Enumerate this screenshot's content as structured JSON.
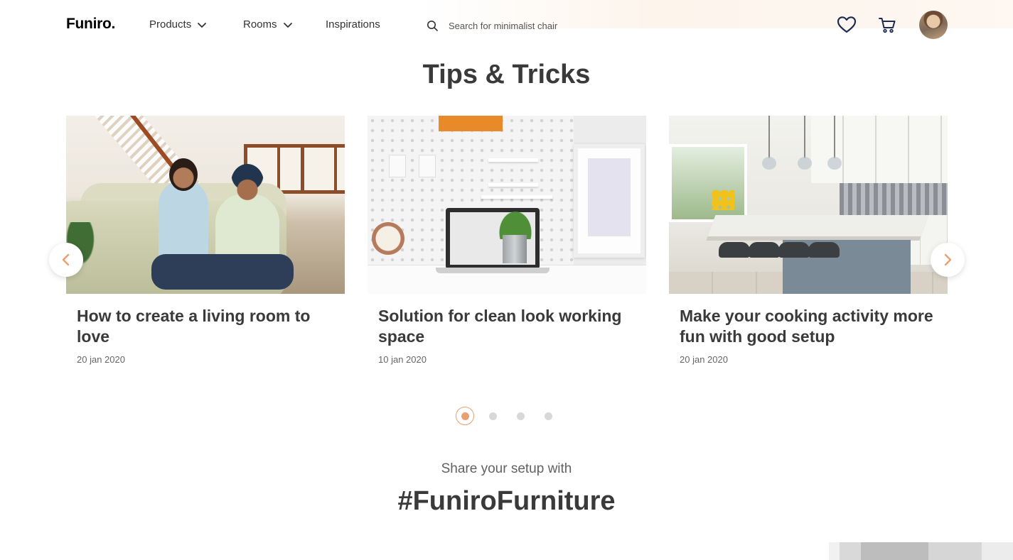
{
  "header": {
    "logo": "Funiro.",
    "nav": [
      {
        "label": "Products",
        "has_dropdown": true
      },
      {
        "label": "Rooms",
        "has_dropdown": true
      },
      {
        "label": "Inspirations",
        "has_dropdown": false
      }
    ],
    "search": {
      "placeholder": "Search for minimalist chair",
      "value": ""
    },
    "icons": [
      "search-icon",
      "heart-icon",
      "cart-icon",
      "avatar"
    ]
  },
  "section": {
    "title": "Tips & Tricks"
  },
  "cards": [
    {
      "title": "How to create a living room to love",
      "date": "20 jan 2020"
    },
    {
      "title": "Solution for clean look working space",
      "date": "10 jan 2020"
    },
    {
      "title": "Make your cooking activity more fun with good setup",
      "date": "20 jan 2020"
    }
  ],
  "carousel": {
    "active_index": 0,
    "dot_count": 4,
    "prev_icon": "chevron-left-icon",
    "next_icon": "chevron-right-icon"
  },
  "share": {
    "subtitle": "Share your setup with",
    "hashtag": "#FuniroFurniture"
  },
  "colors": {
    "accent": "#E89F71",
    "text": "#3A3A3A",
    "muted": "#616161"
  }
}
